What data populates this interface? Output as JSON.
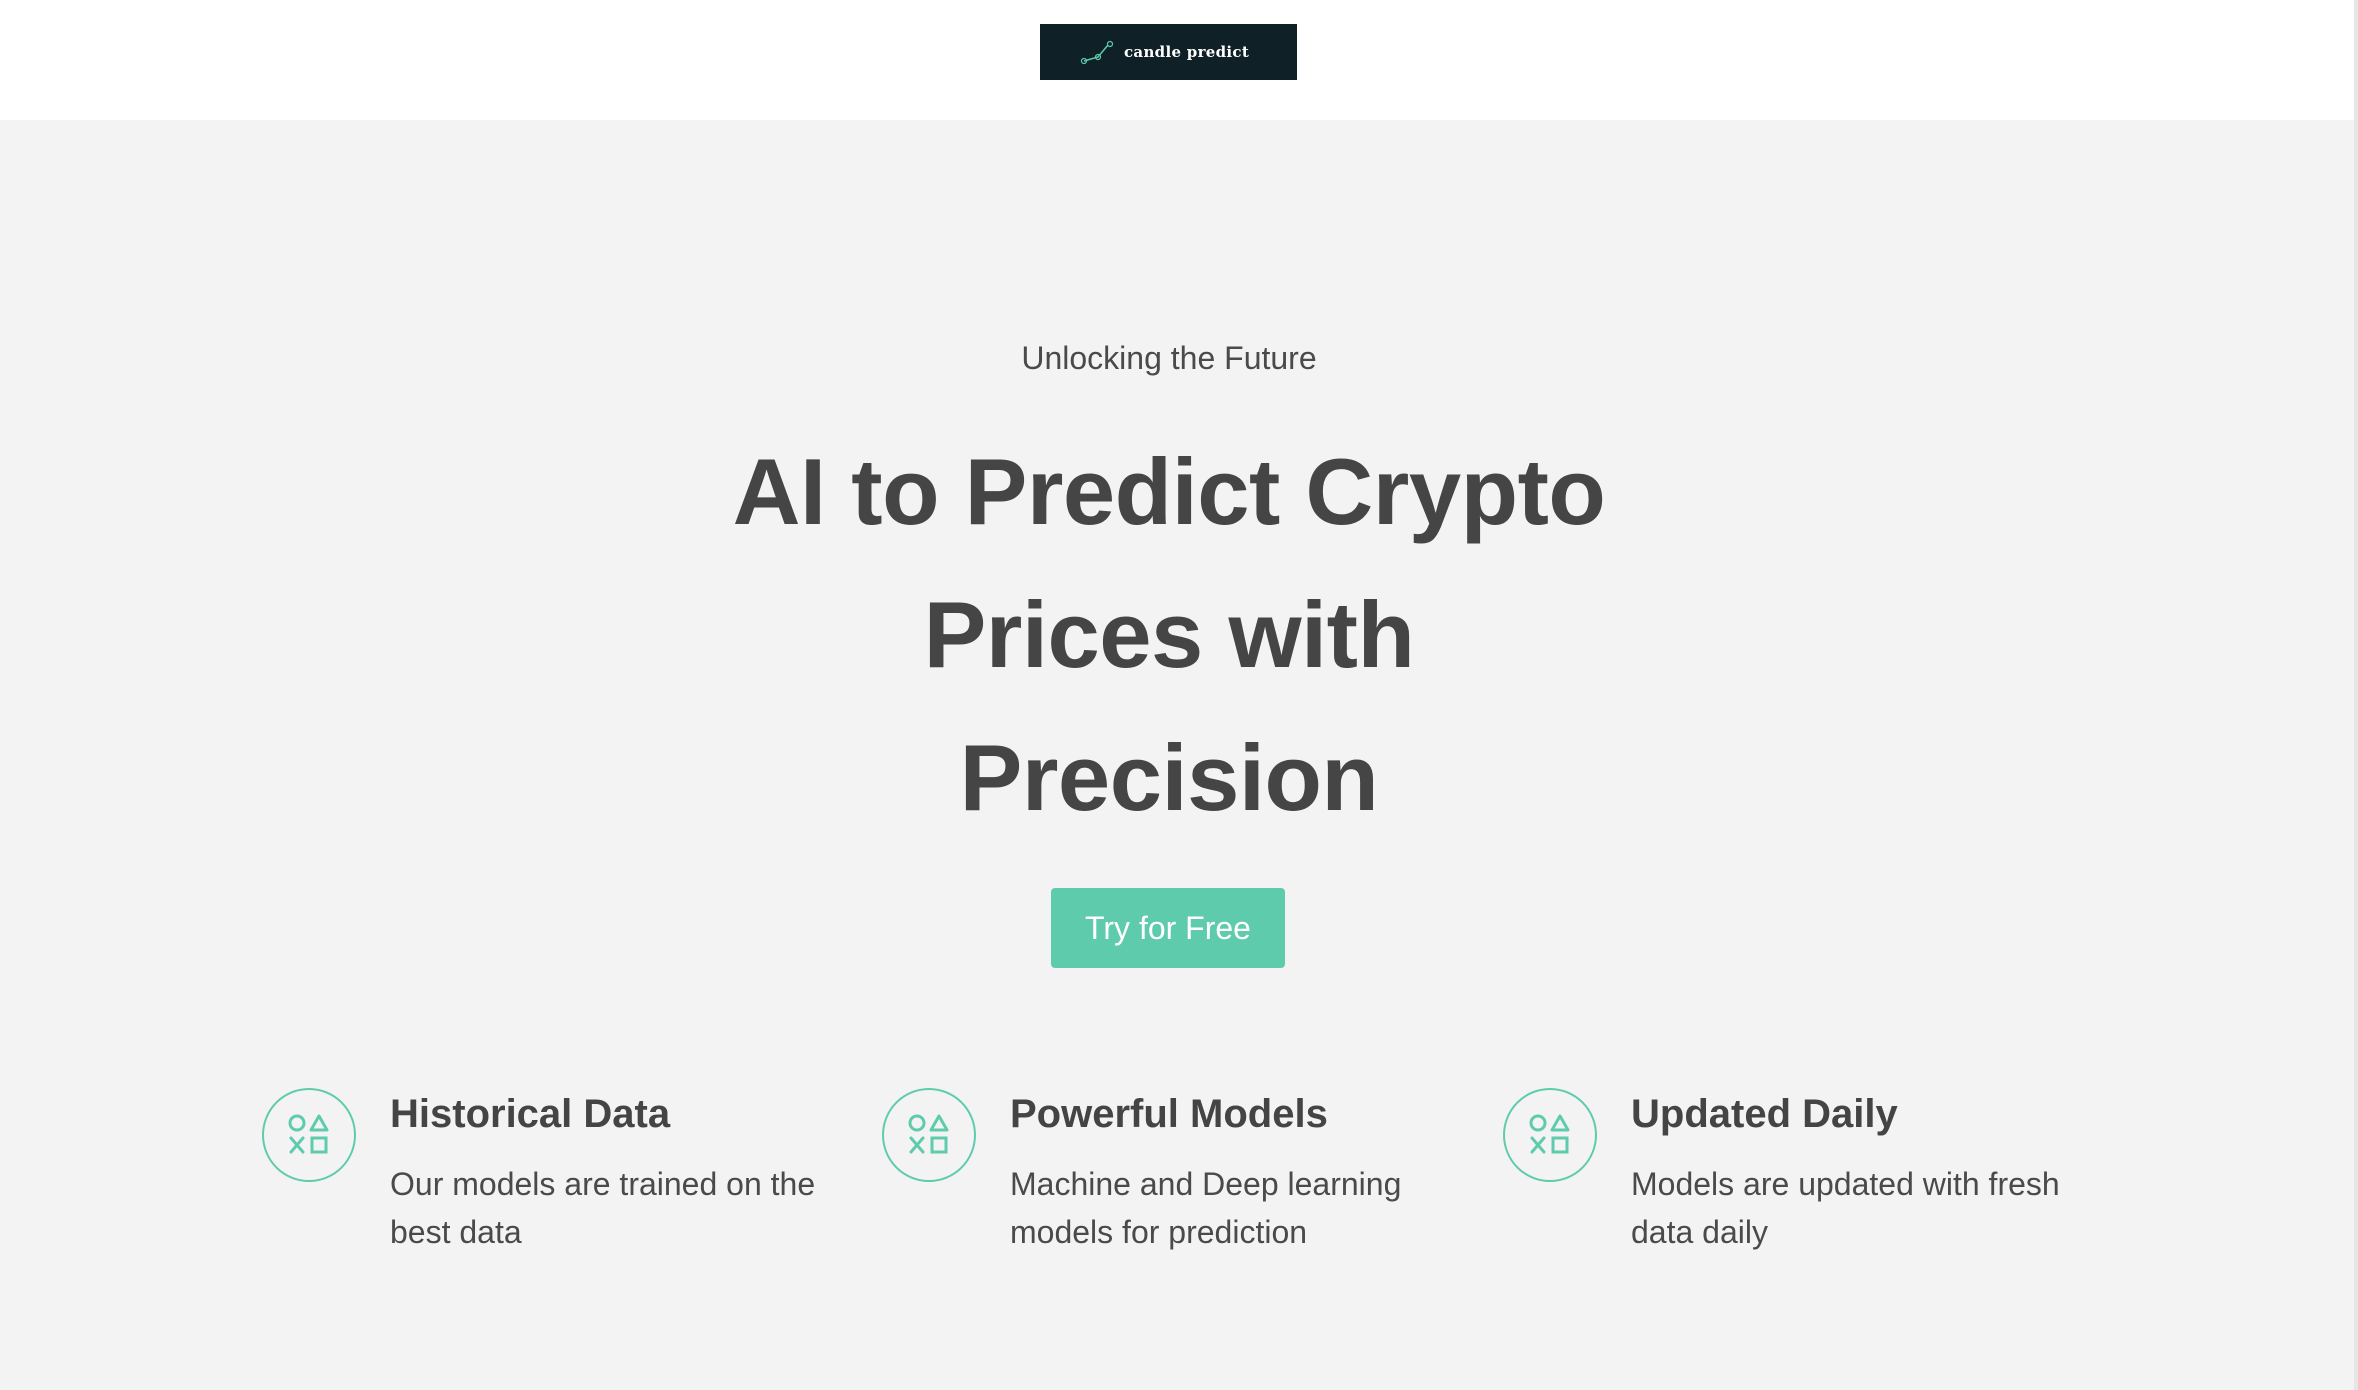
{
  "header": {
    "logo_text": "candle predict"
  },
  "hero": {
    "eyebrow": "Unlocking the Future",
    "headline_line1": "AI to Predict Crypto",
    "headline_line2": "Prices with",
    "headline_line3": "Precision",
    "cta_label": "Try for Free"
  },
  "features": [
    {
      "icon": "shapes-icon",
      "title": "Historical Data",
      "description_line1": "Our models are trained on the",
      "description_line2": "best data"
    },
    {
      "icon": "shapes-icon",
      "title": "Powerful Models",
      "description_line1": "Machine and Deep learning",
      "description_line2": "models for prediction"
    },
    {
      "icon": "shapes-icon",
      "title": "Updated Daily",
      "description_line1": "Models are updated with fresh",
      "description_line2": "data daily"
    }
  ],
  "colors": {
    "accent": "#5ecbad",
    "text": "#444444",
    "background": "#f3f3f3",
    "header_background": "#ffffff",
    "logo_background": "#0f2126"
  }
}
